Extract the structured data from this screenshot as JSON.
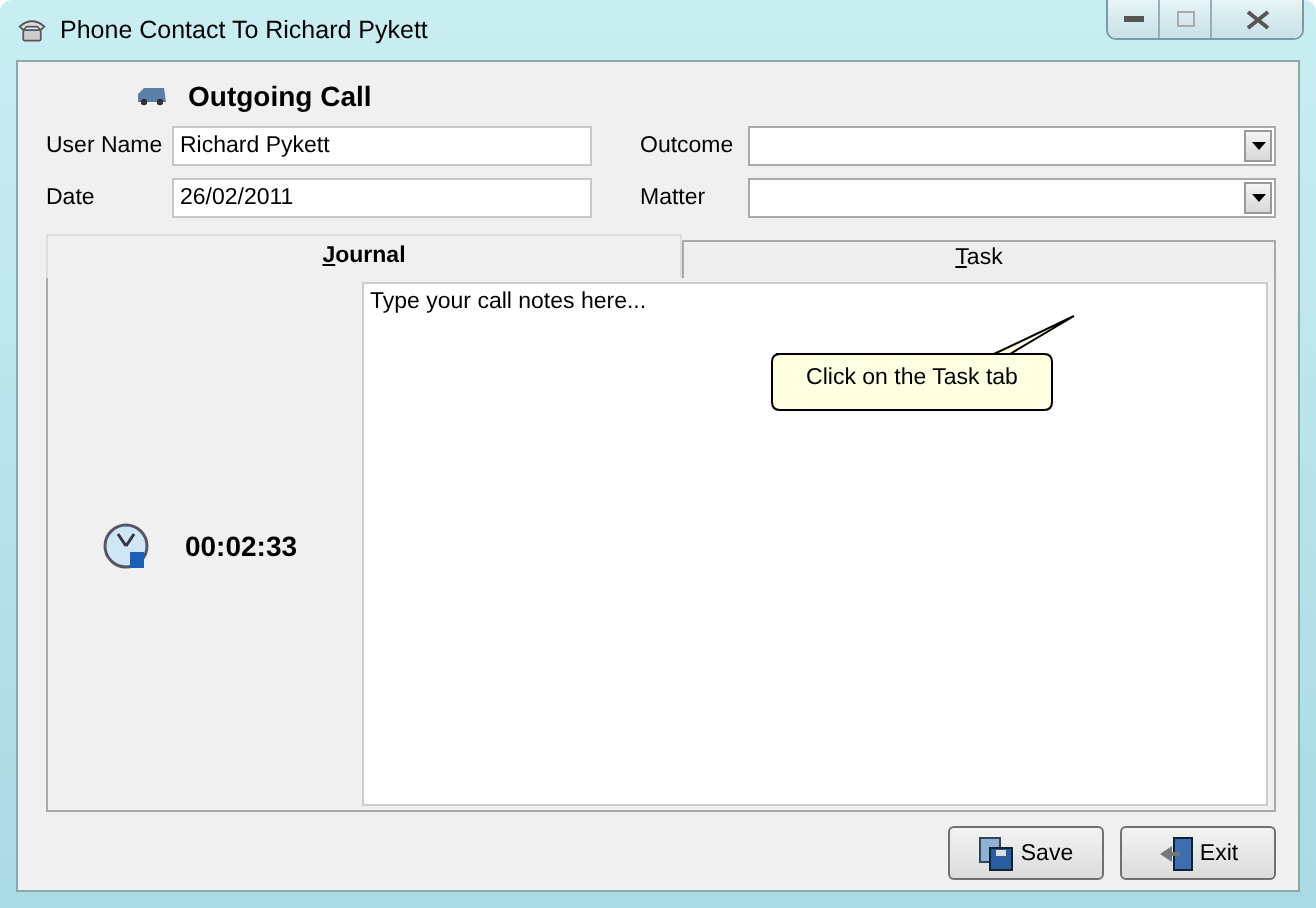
{
  "window": {
    "title": "Phone Contact To Richard Pykett"
  },
  "header": {
    "title": "Outgoing Call"
  },
  "fields": [
    {
      "label": "User Name",
      "value": "Richard Pykett"
    },
    {
      "label": "Date",
      "value": "26/02/2011"
    }
  ],
  "dropdowns": [
    {
      "label": "Outcome"
    },
    {
      "label": "Matter"
    }
  ],
  "tabs": [
    {
      "label": "Journal",
      "selected": true
    },
    {
      "label": "Task",
      "selected": false
    }
  ],
  "timer": "00:02:33",
  "notes": {
    "placeholder": "Type your call notes here..."
  },
  "tooltip": "Click on the Task tab",
  "buttons": [
    {
      "label": "Save",
      "kind": "save"
    },
    {
      "label": "Exit",
      "kind": "exit"
    }
  ]
}
